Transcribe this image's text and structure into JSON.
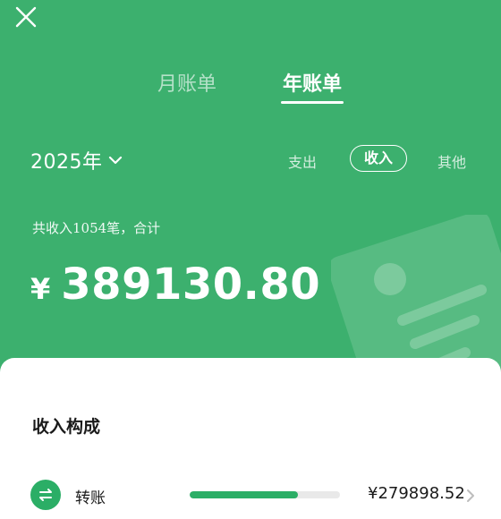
{
  "header": {
    "close_icon": "close-icon",
    "tabs": [
      {
        "label": "月账单",
        "active": false
      },
      {
        "label": "年账单",
        "active": true
      }
    ]
  },
  "year_selector": {
    "label": "2025年",
    "icon": "chevron-down-icon"
  },
  "filters": [
    {
      "label": "支出",
      "active": false
    },
    {
      "label": "收入",
      "active": true
    },
    {
      "label": "其他",
      "active": false
    }
  ],
  "summary": {
    "count_text": "共收入1054笔，合计",
    "currency": "¥",
    "total": "389130.80"
  },
  "breakdown": {
    "title": "收入构成",
    "items": [
      {
        "icon": "transfer-icon",
        "name": "转账",
        "share": 0.72,
        "amount": "¥279898.52"
      }
    ]
  },
  "colors": {
    "background": "#3CB06E",
    "accent": "#2BAE66",
    "card": "#FFFFFF",
    "bar_track": "#E9E9E9"
  }
}
